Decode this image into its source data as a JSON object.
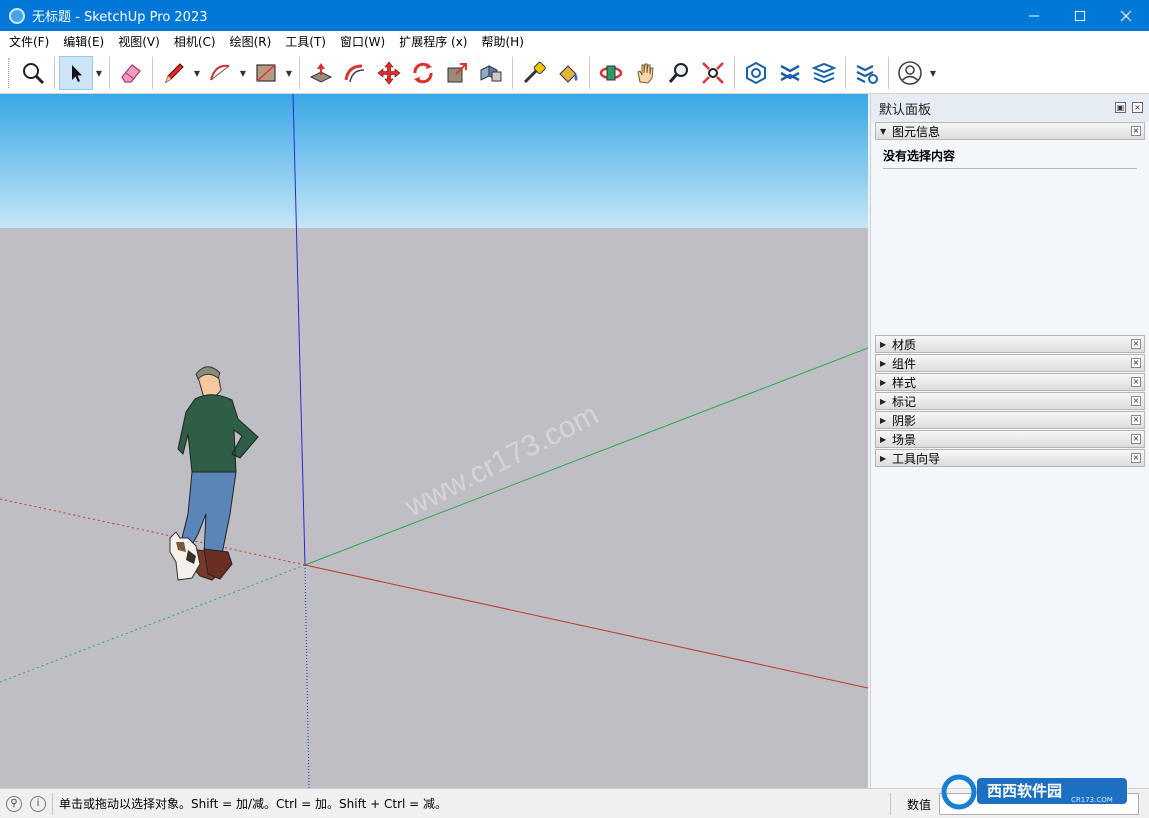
{
  "window": {
    "title": "无标题 - SketchUp Pro 2023"
  },
  "menu": {
    "items": [
      "文件(F)",
      "编辑(E)",
      "视图(V)",
      "相机(C)",
      "绘图(R)",
      "工具(T)",
      "窗口(W)",
      "扩展程序 (x)",
      "帮助(H)"
    ]
  },
  "toolbar": {
    "tools": [
      "search-icon",
      "select-arrow-icon",
      "eraser-icon",
      "pencil-icon",
      "arc-icon",
      "rectangle-icon",
      "push-pull-icon",
      "offset-icon",
      "move-icon",
      "rotate-icon",
      "scale-icon",
      "solid-tools-icon",
      "tape-measure-icon",
      "paint-bucket-icon",
      "orbit-icon",
      "pan-icon",
      "zoom-icon",
      "zoom-extents-icon",
      "warehouse-icon",
      "extension-warehouse-icon",
      "layout-icon",
      "extension-manager-icon",
      "account-icon"
    ]
  },
  "viewport": {
    "watermark": "www.cr173.com",
    "colors": {
      "sky_top": "#38a7e6",
      "sky_bottom": "#c5e6f7",
      "ground": "#bfbec4",
      "axis_red": "#c0392b",
      "axis_green": "#2fa84f",
      "axis_blue": "#2a2ad0"
    }
  },
  "panel": {
    "title": "默认面板",
    "entity_info": {
      "label": "图元信息",
      "content": "没有选择内容"
    },
    "trays": [
      "材质",
      "组件",
      "样式",
      "标记",
      "阴影",
      "场景",
      "工具向导"
    ]
  },
  "status": {
    "hint": "单击或拖动以选择对象。Shift = 加/减。Ctrl = 加。Shift + Ctrl = 减。",
    "measure_label": "数值",
    "measure_value": ""
  },
  "badge": {
    "text": "西西软件园",
    "url_text": "CR173.COM"
  }
}
